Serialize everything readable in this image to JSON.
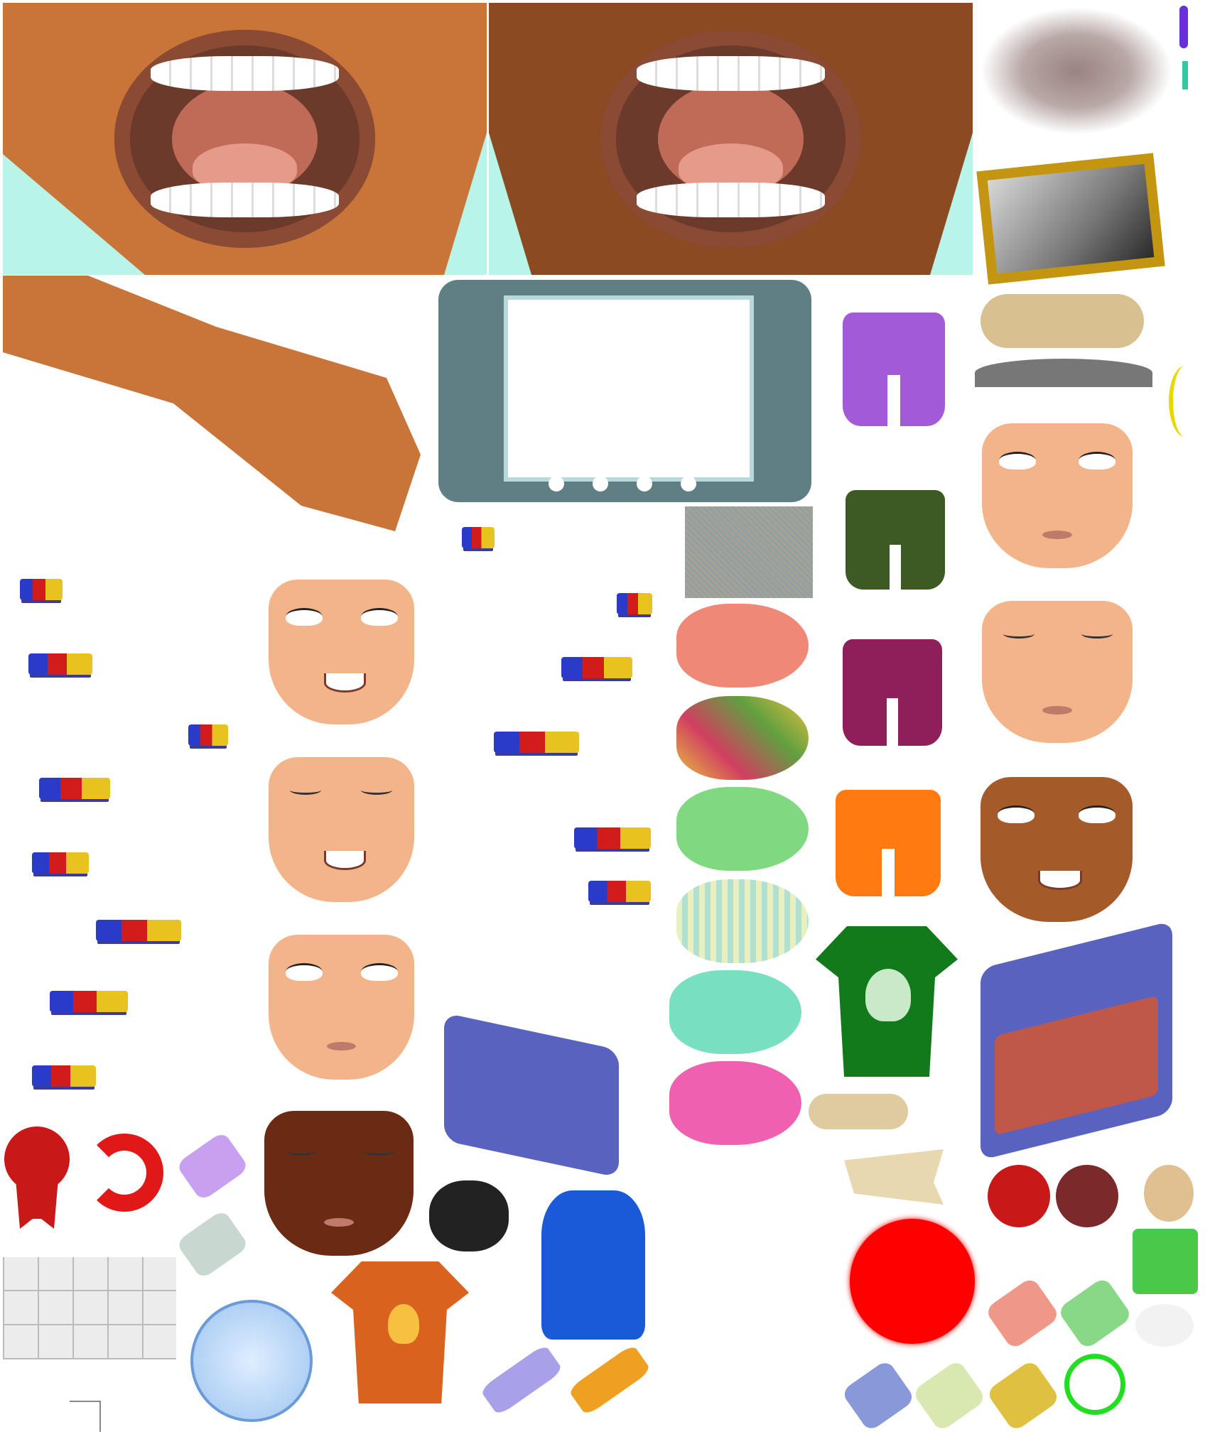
{
  "colors": {
    "skin_light": "#c9753a",
    "skin_dark": "#8b4a22",
    "mint_background": "#b8f5e8",
    "face_peach": "#f4b48a",
    "red_circle": "#ff0000",
    "green_ring": "#22dd22"
  }
}
